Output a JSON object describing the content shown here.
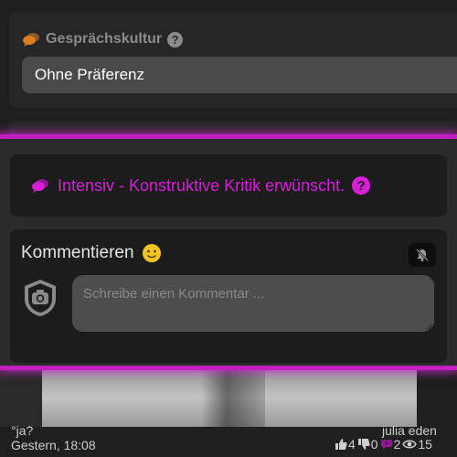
{
  "preference": {
    "label": "Gesprächskultur",
    "help_icon": "?",
    "selected_value": "Ohne Präferenz"
  },
  "intensity": {
    "text": "Intensiv - Konstruktive Kritik erwünscht.",
    "help_icon": "?",
    "accent_color": "#d61fd6"
  },
  "comment": {
    "title": "Kommentieren",
    "placeholder": "Schreibe einen Kommentar ..."
  },
  "post": {
    "title": "°ja?",
    "date": "Gestern, 18:08",
    "author": "julia eden",
    "likes": "4",
    "dislikes": "0",
    "comments": "2",
    "views": "15"
  },
  "icons": [
    "chat-bubbles-icon",
    "help-icon",
    "smiley-icon",
    "bell-off-icon",
    "avatar-icon",
    "thumbs-up-icon",
    "thumbs-down-icon",
    "comment-icon",
    "eye-icon"
  ]
}
